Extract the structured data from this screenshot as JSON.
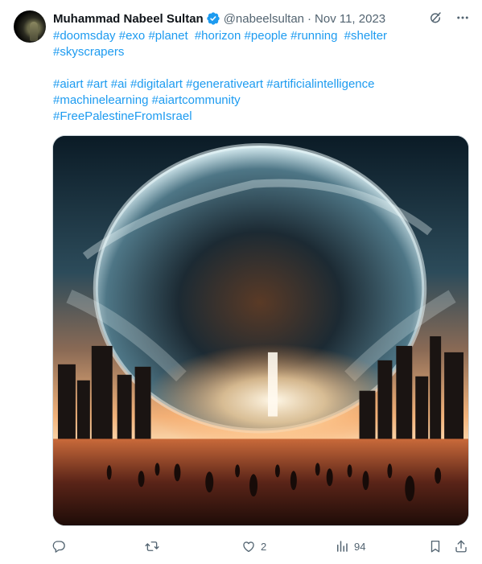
{
  "author": {
    "name": "Muhammad Nabeel Sultan",
    "handle": "@nabeelsultan",
    "separator": "·",
    "date": "Nov 11, 2023"
  },
  "text_lines": [
    [
      "#doomsday",
      "#exo",
      "#planet",
      "#horizon",
      "#people",
      "#running",
      "#shelter"
    ],
    [
      "#skyscrapers"
    ],
    [],
    [
      "#aiart",
      "#art",
      "#ai",
      "#digitalart",
      "#generativeart",
      "#artificialintelligence"
    ],
    [
      "#machinelearning",
      "#aiartcommunity"
    ],
    [
      "#FreePalestineFromIsrael"
    ]
  ],
  "icons": {
    "verified": "verified-badge-icon",
    "grok": "grok-icon",
    "more": "more-icon",
    "reply": "reply-icon",
    "repost": "repost-icon",
    "like": "like-icon",
    "views": "views-icon",
    "bookmark": "bookmark-icon",
    "share": "share-icon"
  },
  "actions": {
    "replies": "",
    "reposts": "",
    "likes": "2",
    "views": "94"
  },
  "colors": {
    "link": "#1d9bf0",
    "text": "#0f1419",
    "muted": "#536471",
    "border": "#cfd9de"
  }
}
